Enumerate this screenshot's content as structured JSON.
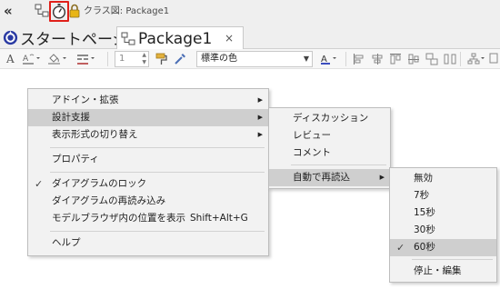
{
  "header": {
    "back_glyph": "«",
    "breadcrumb": "クラス図: Package1",
    "icons": [
      "class-diagram-icon",
      "stopwatch-icon",
      "lock-icon"
    ]
  },
  "tabs": [
    {
      "label": "スタートページ",
      "icon": "start-page-icon",
      "active": false
    },
    {
      "label": "Package1",
      "icon": "class-diagram-icon",
      "active": true,
      "close": "×"
    }
  ],
  "toolbar": {
    "font_size_value": "1",
    "fill_color_label": "標準の色"
  },
  "context_menu": {
    "items": [
      {
        "label": "アドイン・拡張",
        "has_submenu": true
      },
      {
        "label": "設計支援",
        "has_submenu": true,
        "highlighted": true
      },
      {
        "label": "表示形式の切り替え",
        "has_submenu": true
      },
      {
        "label": "プロパティ"
      },
      {
        "label": "ダイアグラムのロック",
        "checked": true
      },
      {
        "label": "ダイアグラムの再読み込み"
      },
      {
        "label": "モデルブラウザ内の位置を表示",
        "shortcut": "Shift+Alt+G"
      },
      {
        "label": "ヘルプ"
      }
    ]
  },
  "design_support_menu": {
    "items": [
      {
        "label": "ディスカッション"
      },
      {
        "label": "レビュー"
      },
      {
        "label": "コメント"
      },
      {
        "label": "自動で再読込",
        "has_submenu": true,
        "highlighted": true
      }
    ]
  },
  "auto_reload_menu": {
    "items": [
      {
        "label": "無効"
      },
      {
        "label": "7秒"
      },
      {
        "label": "15秒"
      },
      {
        "label": "30秒"
      },
      {
        "label": "60秒",
        "checked": true,
        "highlighted": true
      },
      {
        "label": "停止・編集"
      }
    ]
  },
  "colors": {
    "menu_bg": "#f2f2f2",
    "menu_highlight": "#cfcfcf",
    "highlight_box": "#e0201a",
    "chrome_bg": "#efefef"
  }
}
